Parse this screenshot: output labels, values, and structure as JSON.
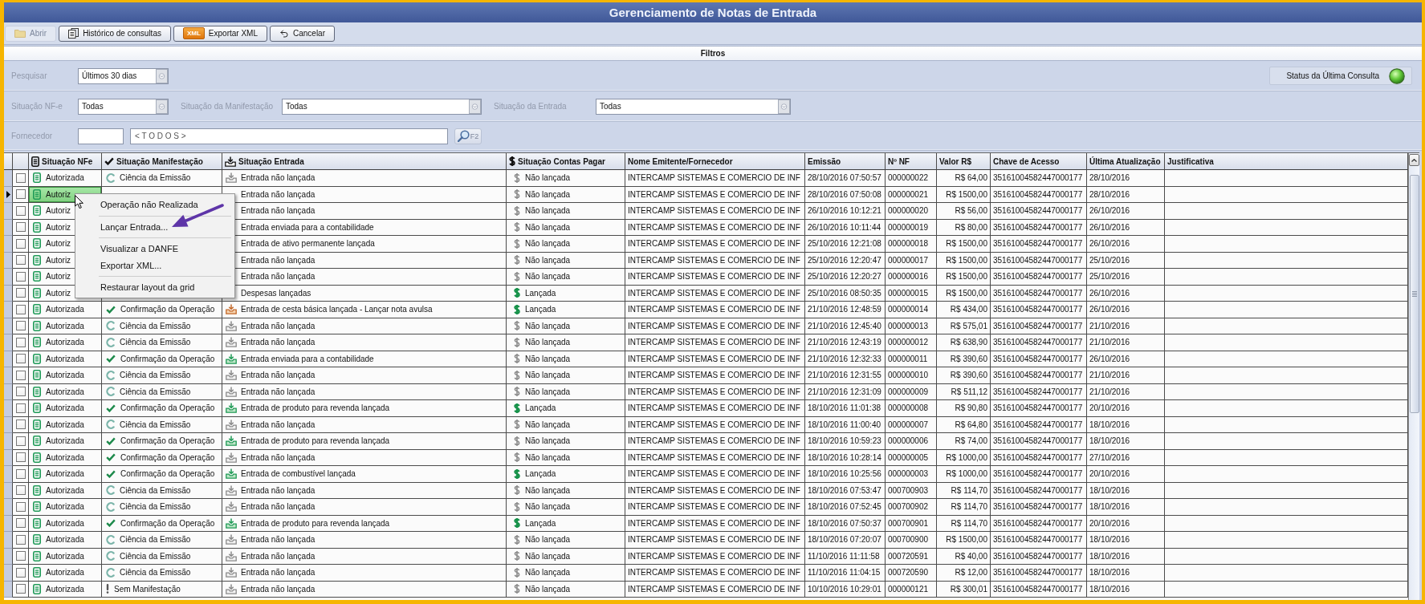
{
  "window": {
    "title": "Gerenciamento de Notas de Entrada"
  },
  "toolbar": [
    {
      "kind": "folder",
      "label": "Abrir",
      "disabled": true
    },
    {
      "kind": "pages",
      "label": "Histórico de consultas",
      "disabled": false
    },
    {
      "kind": "badge",
      "badge": "XML",
      "label": "Exportar XML",
      "disabled": false
    },
    {
      "kind": "undo",
      "label": "Cancelar",
      "disabled": false
    }
  ],
  "filters": {
    "title": "Filtros",
    "period": {
      "label": "Pesquisar",
      "value": "Últimos 30 dias"
    },
    "status_button": {
      "label": "Status da Última Consulta",
      "on": true
    },
    "selects": [
      {
        "label": "Situação NF-e",
        "value": "Todas"
      },
      {
        "label": "Situação da Manifestação",
        "value": "Todas"
      },
      {
        "label": "Situação da Entrada",
        "value": "Todas"
      }
    ],
    "supplier": {
      "label": "Fornecedor",
      "value": "< T O D O S >",
      "shortcut": "F2"
    }
  },
  "table": {
    "columns": [
      "Situação NFe",
      "Situação Manifestação",
      "Situação Entrada",
      "Situação Contas Pagar",
      "Nome Emitente/Fornecedor",
      "Emissão",
      "Nº NF",
      "Valor R$",
      "Chave de Acesso",
      "Última Atualização",
      "Justificativa"
    ],
    "rows": [
      {
        "selected": false,
        "checked": false,
        "nfe": {
          "kind": "authorized",
          "text": "Autorizada"
        },
        "manifest": {
          "kind": "ciencia",
          "text": "Ciência da Emissão"
        },
        "entrada": {
          "kind": "pending",
          "text": "Entrada não lançada"
        },
        "contas": {
          "kind": "pending",
          "text": "Não lançada"
        },
        "emitente": "INTERCAMP SISTEMAS E COMERCIO DE INF",
        "emissao": "28/10/2016 07:50:57",
        "nf": "000000022",
        "valor": "R$ 64,00",
        "chave": "35161004582447000177",
        "atualizacao": "28/10/2016"
      },
      {
        "selected": true,
        "checked": false,
        "nfe": {
          "kind": "authorized",
          "text": "Autoriz"
        },
        "entrada": {
          "text": "Entrada não lançada"
        },
        "contas": {
          "kind": "pending",
          "text": "Não lançada"
        },
        "emitente": "INTERCAMP SISTEMAS E COMERCIO DE INF",
        "emissao": "28/10/2016 07:50:08",
        "nf": "000000021",
        "valor": "R$ 1500,00",
        "chave": "35161004582447000177",
        "atualizacao": "28/10/2016"
      },
      {
        "selected": false,
        "checked": false,
        "nfe": {
          "kind": "authorized",
          "text": "Autoriz"
        },
        "entrada": {
          "text": "Entrada não lançada"
        },
        "contas": {
          "kind": "pending",
          "text": "Não lançada"
        },
        "emitente": "INTERCAMP SISTEMAS E COMERCIO DE INF",
        "emissao": "26/10/2016 10:12:21",
        "nf": "000000020",
        "valor": "R$ 56,00",
        "chave": "35161004582447000177",
        "atualizacao": "26/10/2016"
      },
      {
        "selected": false,
        "checked": false,
        "nfe": {
          "kind": "authorized",
          "text": "Autoriz"
        },
        "entrada": {
          "text": "Entrada enviada para a contabilidade"
        },
        "contas": {
          "kind": "pending",
          "text": "Não lançada"
        },
        "emitente": "INTERCAMP SISTEMAS E COMERCIO DE INF",
        "emissao": "26/10/2016 10:11:44",
        "nf": "000000019",
        "valor": "R$ 80,00",
        "chave": "35161004582447000177",
        "atualizacao": "26/10/2016"
      },
      {
        "selected": false,
        "checked": false,
        "nfe": {
          "kind": "authorized",
          "text": "Autoriz"
        },
        "entrada": {
          "text": "Entrada de ativo permanente lançada"
        },
        "contas": {
          "kind": "pending",
          "text": "Não lançada"
        },
        "emitente": "INTERCAMP SISTEMAS E COMERCIO DE INF",
        "emissao": "25/10/2016 12:21:08",
        "nf": "000000018",
        "valor": "R$ 1500,00",
        "chave": "35161004582447000177",
        "atualizacao": "26/10/2016"
      },
      {
        "selected": false,
        "checked": false,
        "nfe": {
          "kind": "authorized",
          "text": "Autoriz"
        },
        "entrada": {
          "text": "Entrada não lançada"
        },
        "contas": {
          "kind": "pending",
          "text": "Não lançada"
        },
        "emitente": "INTERCAMP SISTEMAS E COMERCIO DE INF",
        "emissao": "25/10/2016 12:20:47",
        "nf": "000000017",
        "valor": "R$ 1500,00",
        "chave": "35161004582447000177",
        "atualizacao": "25/10/2016"
      },
      {
        "selected": false,
        "checked": false,
        "nfe": {
          "kind": "authorized",
          "text": "Autoriz"
        },
        "entrada": {
          "text": "Entrada não lançada"
        },
        "contas": {
          "kind": "pending",
          "text": "Não lançada"
        },
        "emitente": "INTERCAMP SISTEMAS E COMERCIO DE INF",
        "emissao": "25/10/2016 12:20:27",
        "nf": "000000016",
        "valor": "R$ 1500,00",
        "chave": "35161004582447000177",
        "atualizacao": "25/10/2016"
      },
      {
        "selected": false,
        "checked": false,
        "nfe": {
          "kind": "authorized",
          "text": "Autoriz"
        },
        "entrada": {
          "text": "Despesas lançadas"
        },
        "contas": {
          "kind": "posted",
          "text": "Lançada"
        },
        "emitente": "INTERCAMP SISTEMAS E COMERCIO DE INF",
        "emissao": "25/10/2016 08:50:35",
        "nf": "000000015",
        "valor": "R$ 1500,00",
        "chave": "35161004582447000177",
        "atualizacao": "26/10/2016"
      },
      {
        "selected": false,
        "checked": false,
        "nfe": {
          "kind": "authorized",
          "text": "Autorizada"
        },
        "manifest": {
          "kind": "confirmed",
          "text": "Confirmação da Operação"
        },
        "entrada": {
          "kind": "basket",
          "text": "Entrada de cesta básica lançada - Lançar nota avulsa"
        },
        "contas": {
          "kind": "posted",
          "text": "Lançada"
        },
        "emitente": "INTERCAMP SISTEMAS E COMERCIO DE INF",
        "emissao": "21/10/2016 12:48:59",
        "nf": "000000014",
        "valor": "R$ 434,00",
        "chave": "35161004582447000177",
        "atualizacao": "26/10/2016"
      },
      {
        "selected": false,
        "checked": false,
        "nfe": {
          "kind": "authorized",
          "text": "Autorizada"
        },
        "manifest": {
          "kind": "ciencia",
          "text": "Ciência da Emissão"
        },
        "entrada": {
          "kind": "pending",
          "text": "Entrada não lançada"
        },
        "contas": {
          "kind": "pending",
          "text": "Não lançada"
        },
        "emitente": "INTERCAMP SISTEMAS E COMERCIO DE INF",
        "emissao": "21/10/2016 12:45:40",
        "nf": "000000013",
        "valor": "R$ 575,01",
        "chave": "35161004582447000177",
        "atualizacao": "21/10/2016"
      },
      {
        "selected": false,
        "checked": false,
        "nfe": {
          "kind": "authorized",
          "text": "Autorizada"
        },
        "manifest": {
          "kind": "ciencia",
          "text": "Ciência da Emissão"
        },
        "entrada": {
          "kind": "pending",
          "text": "Entrada não lançada"
        },
        "contas": {
          "kind": "pending",
          "text": "Não lançada"
        },
        "emitente": "INTERCAMP SISTEMAS E COMERCIO DE INF",
        "emissao": "21/10/2016 12:43:19",
        "nf": "000000012",
        "valor": "R$ 638,90",
        "chave": "35161004582447000177",
        "atualizacao": "21/10/2016"
      },
      {
        "selected": false,
        "checked": false,
        "nfe": {
          "kind": "authorized",
          "text": "Autorizada"
        },
        "manifest": {
          "kind": "confirmed",
          "text": "Confirmação da Operação"
        },
        "entrada": {
          "kind": "posted",
          "text": "Entrada enviada para a contabilidade"
        },
        "contas": {
          "kind": "pending",
          "text": "Não lançada"
        },
        "emitente": "INTERCAMP SISTEMAS E COMERCIO DE INF",
        "emissao": "21/10/2016 12:32:33",
        "nf": "000000011",
        "valor": "R$ 390,60",
        "chave": "35161004582447000177",
        "atualizacao": "26/10/2016"
      },
      {
        "selected": false,
        "checked": false,
        "nfe": {
          "kind": "authorized",
          "text": "Autorizada"
        },
        "manifest": {
          "kind": "ciencia",
          "text": "Ciência da Emissão"
        },
        "entrada": {
          "kind": "pending",
          "text": "Entrada não lançada"
        },
        "contas": {
          "kind": "pending",
          "text": "Não lançada"
        },
        "emitente": "INTERCAMP SISTEMAS E COMERCIO DE INF",
        "emissao": "21/10/2016 12:31:55",
        "nf": "000000010",
        "valor": "R$ 390,60",
        "chave": "35161004582447000177",
        "atualizacao": "21/10/2016"
      },
      {
        "selected": false,
        "checked": false,
        "nfe": {
          "kind": "authorized",
          "text": "Autorizada"
        },
        "manifest": {
          "kind": "ciencia",
          "text": "Ciência da Emissão"
        },
        "entrada": {
          "kind": "pending",
          "text": "Entrada não lançada"
        },
        "contas": {
          "kind": "pending",
          "text": "Não lançada"
        },
        "emitente": "INTERCAMP SISTEMAS E COMERCIO DE INF",
        "emissao": "21/10/2016 12:31:09",
        "nf": "000000009",
        "valor": "R$ 511,12",
        "chave": "35161004582447000177",
        "atualizacao": "21/10/2016"
      },
      {
        "selected": false,
        "checked": false,
        "nfe": {
          "kind": "authorized",
          "text": "Autorizada"
        },
        "manifest": {
          "kind": "confirmed",
          "text": "Confirmação da Operação"
        },
        "entrada": {
          "kind": "posted",
          "text": "Entrada de produto para revenda lançada"
        },
        "contas": {
          "kind": "posted",
          "text": "Lançada"
        },
        "emitente": "INTERCAMP SISTEMAS E COMERCIO DE INF",
        "emissao": "18/10/2016 11:01:38",
        "nf": "000000008",
        "valor": "R$ 90,80",
        "chave": "35161004582447000177",
        "atualizacao": "20/10/2016"
      },
      {
        "selected": false,
        "checked": false,
        "nfe": {
          "kind": "authorized",
          "text": "Autorizada"
        },
        "manifest": {
          "kind": "ciencia",
          "text": "Ciência da Emissão"
        },
        "entrada": {
          "kind": "pending",
          "text": "Entrada não lançada"
        },
        "contas": {
          "kind": "pending",
          "text": "Não lançada"
        },
        "emitente": "INTERCAMP SISTEMAS E COMERCIO DE INF",
        "emissao": "18/10/2016 11:00:40",
        "nf": "000000007",
        "valor": "R$ 64,80",
        "chave": "35161004582447000177",
        "atualizacao": "18/10/2016"
      },
      {
        "selected": false,
        "checked": false,
        "nfe": {
          "kind": "authorized",
          "text": "Autorizada"
        },
        "manifest": {
          "kind": "confirmed",
          "text": "Confirmação da Operação"
        },
        "entrada": {
          "kind": "posted",
          "text": "Entrada de produto para revenda lançada"
        },
        "contas": {
          "kind": "pending",
          "text": "Não lançada"
        },
        "emitente": "INTERCAMP SISTEMAS E COMERCIO DE INF",
        "emissao": "18/10/2016 10:59:23",
        "nf": "000000006",
        "valor": "R$ 74,00",
        "chave": "35161004582447000177",
        "atualizacao": "18/10/2016"
      },
      {
        "selected": false,
        "checked": false,
        "nfe": {
          "kind": "authorized",
          "text": "Autorizada"
        },
        "manifest": {
          "kind": "confirmed",
          "text": "Confirmação da Operação"
        },
        "entrada": {
          "kind": "pending",
          "text": "Entrada não lançada"
        },
        "contas": {
          "kind": "pending",
          "text": "Não lançada"
        },
        "emitente": "INTERCAMP SISTEMAS E COMERCIO DE INF",
        "emissao": "18/10/2016 10:28:14",
        "nf": "000000005",
        "valor": "R$ 1000,00",
        "chave": "35161004582447000177",
        "atualizacao": "27/10/2016"
      },
      {
        "selected": false,
        "checked": false,
        "nfe": {
          "kind": "authorized",
          "text": "Autorizada"
        },
        "manifest": {
          "kind": "confirmed",
          "text": "Confirmação da Operação"
        },
        "entrada": {
          "kind": "posted",
          "text": "Entrada de combustível lançada"
        },
        "contas": {
          "kind": "posted",
          "text": "Lançada"
        },
        "emitente": "INTERCAMP SISTEMAS E COMERCIO DE INF",
        "emissao": "18/10/2016 10:25:56",
        "nf": "000000003",
        "valor": "R$ 1000,00",
        "chave": "35161004582447000177",
        "atualizacao": "20/10/2016"
      },
      {
        "selected": false,
        "checked": false,
        "nfe": {
          "kind": "authorized",
          "text": "Autorizada"
        },
        "manifest": {
          "kind": "ciencia",
          "text": "Ciência da Emissão"
        },
        "entrada": {
          "kind": "pending",
          "text": "Entrada não lançada"
        },
        "contas": {
          "kind": "pending",
          "text": "Não lançada"
        },
        "emitente": "INTERCAMP SISTEMAS E COMERCIO DE INF",
        "emissao": "18/10/2016 07:53:47",
        "nf": "000700903",
        "valor": "R$ 114,70",
        "chave": "35161004582447000177",
        "atualizacao": "18/10/2016"
      },
      {
        "selected": false,
        "checked": false,
        "nfe": {
          "kind": "authorized",
          "text": "Autorizada"
        },
        "manifest": {
          "kind": "ciencia",
          "text": "Ciência da Emissão"
        },
        "entrada": {
          "kind": "pending",
          "text": "Entrada não lançada"
        },
        "contas": {
          "kind": "pending",
          "text": "Não lançada"
        },
        "emitente": "INTERCAMP SISTEMAS E COMERCIO DE INF",
        "emissao": "18/10/2016 07:52:45",
        "nf": "000700902",
        "valor": "R$ 114,70",
        "chave": "35161004582447000177",
        "atualizacao": "18/10/2016"
      },
      {
        "selected": false,
        "checked": false,
        "nfe": {
          "kind": "authorized",
          "text": "Autorizada"
        },
        "manifest": {
          "kind": "confirmed",
          "text": "Confirmação da Operação"
        },
        "entrada": {
          "kind": "posted",
          "text": "Entrada de produto para revenda lançada"
        },
        "contas": {
          "kind": "posted",
          "text": "Lançada"
        },
        "emitente": "INTERCAMP SISTEMAS E COMERCIO DE INF",
        "emissao": "18/10/2016 07:50:37",
        "nf": "000700901",
        "valor": "R$ 114,70",
        "chave": "35161004582447000177",
        "atualizacao": "20/10/2016"
      },
      {
        "selected": false,
        "checked": false,
        "nfe": {
          "kind": "authorized",
          "text": "Autorizada"
        },
        "manifest": {
          "kind": "ciencia",
          "text": "Ciência da Emissão"
        },
        "entrada": {
          "kind": "pending",
          "text": "Entrada não lançada"
        },
        "contas": {
          "kind": "pending",
          "text": "Não lançada"
        },
        "emitente": "INTERCAMP SISTEMAS E COMERCIO DE INF",
        "emissao": "18/10/2016 07:20:07",
        "nf": "000700900",
        "valor": "R$ 1500,00",
        "chave": "35161004582447000177",
        "atualizacao": "18/10/2016"
      },
      {
        "selected": false,
        "checked": false,
        "nfe": {
          "kind": "authorized",
          "text": "Autorizada"
        },
        "manifest": {
          "kind": "ciencia",
          "text": "Ciência da Emissão"
        },
        "entrada": {
          "kind": "pending",
          "text": "Entrada não lançada"
        },
        "contas": {
          "kind": "pending",
          "text": "Não lançada"
        },
        "emitente": "INTERCAMP SISTEMAS E COMERCIO DE INF",
        "emissao": "11/10/2016 11:11:58",
        "nf": "000720591",
        "valor": "R$ 40,00",
        "chave": "35161004582447000177",
        "atualizacao": "18/10/2016"
      },
      {
        "selected": false,
        "checked": false,
        "nfe": {
          "kind": "authorized",
          "text": "Autorizada"
        },
        "manifest": {
          "kind": "ciencia",
          "text": "Ciência da Emissão"
        },
        "entrada": {
          "kind": "pending",
          "text": "Entrada não lançada"
        },
        "contas": {
          "kind": "pending",
          "text": "Não lançada"
        },
        "emitente": "INTERCAMP SISTEMAS E COMERCIO DE INF",
        "emissao": "11/10/2016 11:04:15",
        "nf": "000720590",
        "valor": "R$ 12,00",
        "chave": "35161004582447000177",
        "atualizacao": "18/10/2016"
      },
      {
        "selected": false,
        "checked": false,
        "nfe": {
          "kind": "authorized",
          "text": "Autorizada"
        },
        "manifest": {
          "kind": "none",
          "text": "Sem Manifestação"
        },
        "entrada": {
          "kind": "pending",
          "text": "Entrada não lançada"
        },
        "contas": {
          "kind": "pending",
          "text": "Não lançada"
        },
        "emitente": "INTERCAMP SISTEMAS E COMERCIO DE INF",
        "emissao": "10/10/2016 10:29:01",
        "nf": "000000121",
        "valor": "R$ 300,01",
        "chave": "35161004582447000177",
        "atualizacao": "18/10/2016"
      }
    ]
  },
  "context_menu": {
    "groups": [
      [
        "Operação não Realizada"
      ],
      [
        "Lançar Entrada..."
      ],
      [
        "Visualizar a DANFE",
        "Exportar XML..."
      ],
      [
        "Restaurar layout da grid"
      ]
    ]
  }
}
